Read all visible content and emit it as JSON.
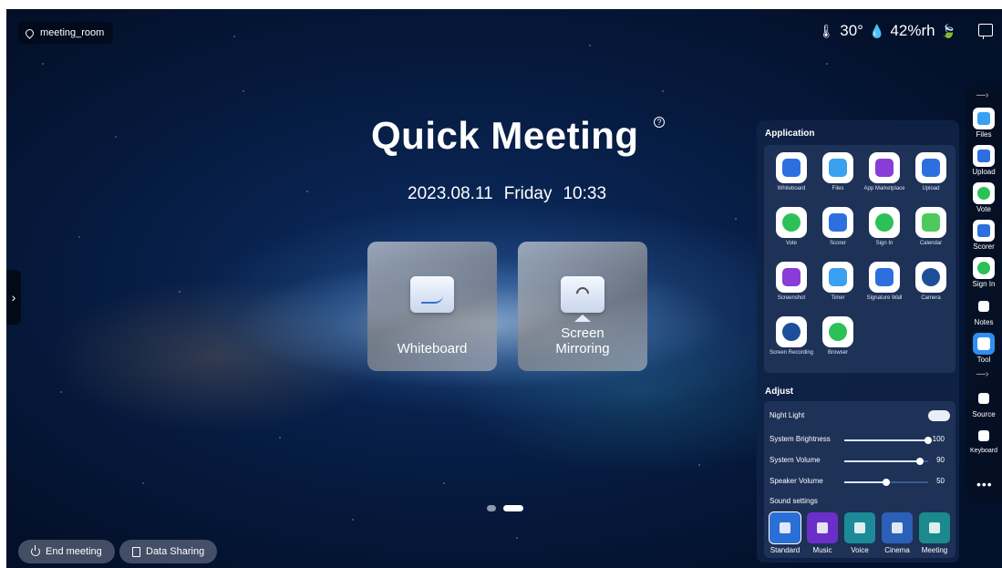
{
  "location": {
    "label": "meeting_room"
  },
  "status": {
    "temperature": "30°",
    "humidity": "42%rh"
  },
  "title": "Quick Meeting",
  "datetime": {
    "date": "2023.08.11",
    "weekday": "Friday",
    "time": "10:33"
  },
  "cards": {
    "whiteboard": "Whiteboard",
    "screen_mirroring_line1": "Screen",
    "screen_mirroring_line2": "Mirroring"
  },
  "bottom": {
    "end_meeting": "End meeting",
    "data_sharing": "Data Sharing"
  },
  "panel": {
    "application_title": "Application",
    "apps": [
      "Whiteboard",
      "Files",
      "App Marketplace",
      "Upload",
      "Vote",
      "Scorer",
      "Sign In",
      "Calendar",
      "Screenshot",
      "Timer",
      "Signature Wall",
      "Camera",
      "Screen Recording",
      "Browser"
    ],
    "adjust_title": "Adjust",
    "night_light": "Night Light",
    "brightness": {
      "label": "System Brightness",
      "value": 100
    },
    "volume": {
      "label": "System Volume",
      "value": 90
    },
    "speaker": {
      "label": "Speaker Volume",
      "value": 50
    },
    "sound_settings": "Sound settings",
    "modes": [
      "Standard",
      "Music",
      "Voice",
      "Cinema",
      "Meeting"
    ],
    "selected_mode": "Standard"
  },
  "sidebar": {
    "items": [
      "Files",
      "Upload",
      "Vote",
      "Scorer",
      "Sign In",
      "Notes",
      "Tool",
      "Source",
      "Keyboard"
    ]
  }
}
